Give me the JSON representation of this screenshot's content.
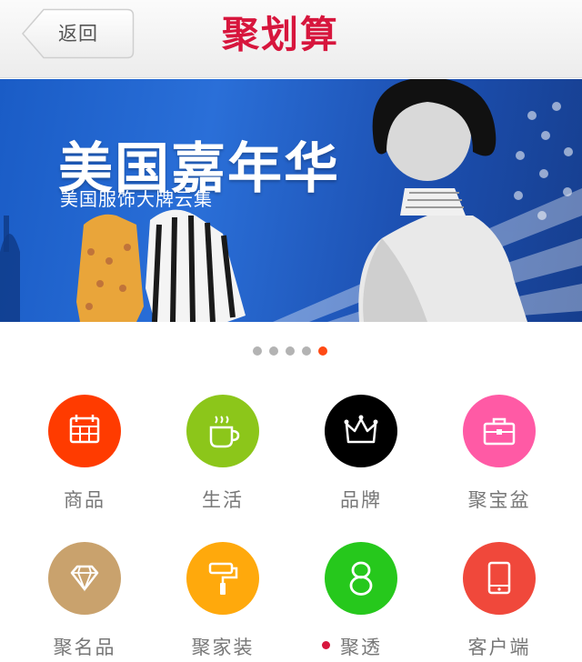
{
  "header": {
    "back_label": "返回",
    "logo_text": "聚划算",
    "logo_color": "#d7163d"
  },
  "banner": {
    "title": "美国嘉年华",
    "subtitle": "美国服饰大牌云集"
  },
  "carousel": {
    "total": 5,
    "active_index": 4
  },
  "categories": [
    {
      "label": "商品",
      "icon": "calendar-icon",
      "color": "#ff3b00"
    },
    {
      "label": "生活",
      "icon": "coffee-cup-icon",
      "color": "#8cc61a"
    },
    {
      "label": "品牌",
      "icon": "crown-icon",
      "color": "#000000"
    },
    {
      "label": "聚宝盆",
      "icon": "briefcase-icon",
      "color": "#ff5aa5"
    },
    {
      "label": "聚名品",
      "icon": "diamond-icon",
      "color": "#c9a26d"
    },
    {
      "label": "聚家装",
      "icon": "paint-roller-icon",
      "color": "#ffa90c"
    },
    {
      "label": "聚透",
      "icon": "eight-icon",
      "color": "#26c81c",
      "badge": "new-dot"
    },
    {
      "label": "客户端",
      "icon": "tablet-icon",
      "color": "#f0483b"
    }
  ]
}
